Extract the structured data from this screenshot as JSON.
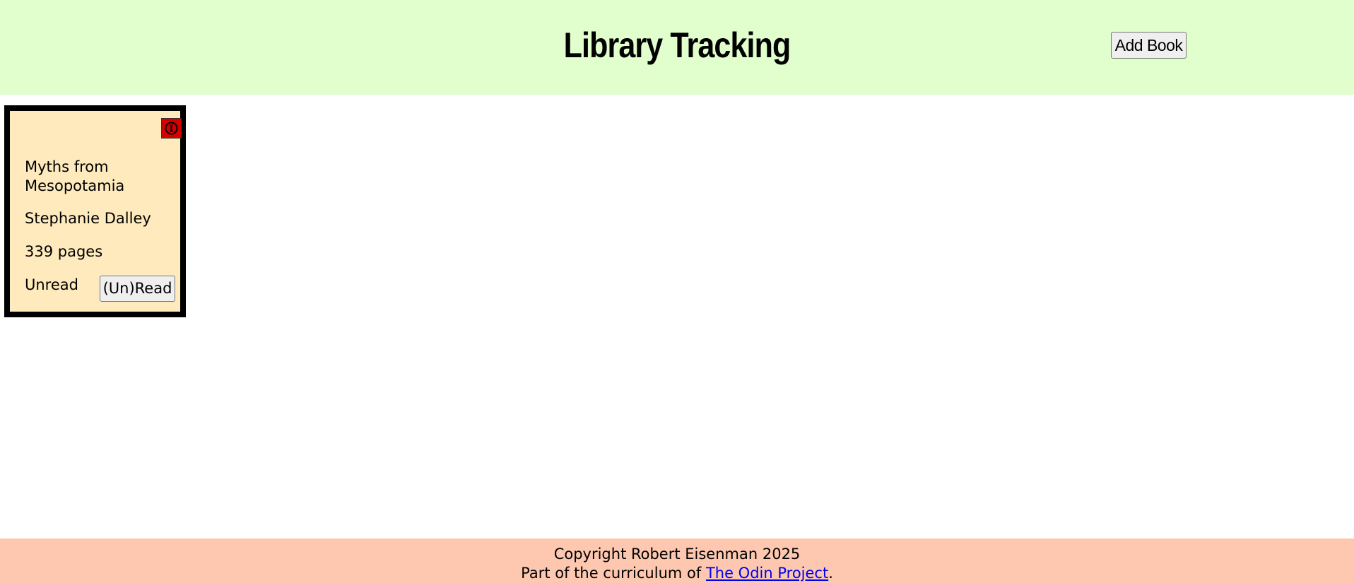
{
  "header": {
    "title": "Library Tracking",
    "add_button_label": "Add Book"
  },
  "books": [
    {
      "title": "Myths from Mesopotamia",
      "author": "Stephanie Dalley",
      "pages": "339 pages",
      "status": "Unread",
      "toggle_label": "(Un)Read",
      "remove_icon": "remove-circle-icon"
    }
  ],
  "footer": {
    "copyright": "Copyright Robert Eisenman 2025",
    "curriculum_prefix": "Part of the curriculum of ",
    "link_text": "The Odin Project",
    "curriculum_suffix": "."
  },
  "colors": {
    "header_bg": "#e0ffcc",
    "card_bg": "#feeabd",
    "card_border": "#000000",
    "remove_button": "#d40000",
    "footer_bg": "#fec8b0",
    "link": "#0000ee"
  }
}
